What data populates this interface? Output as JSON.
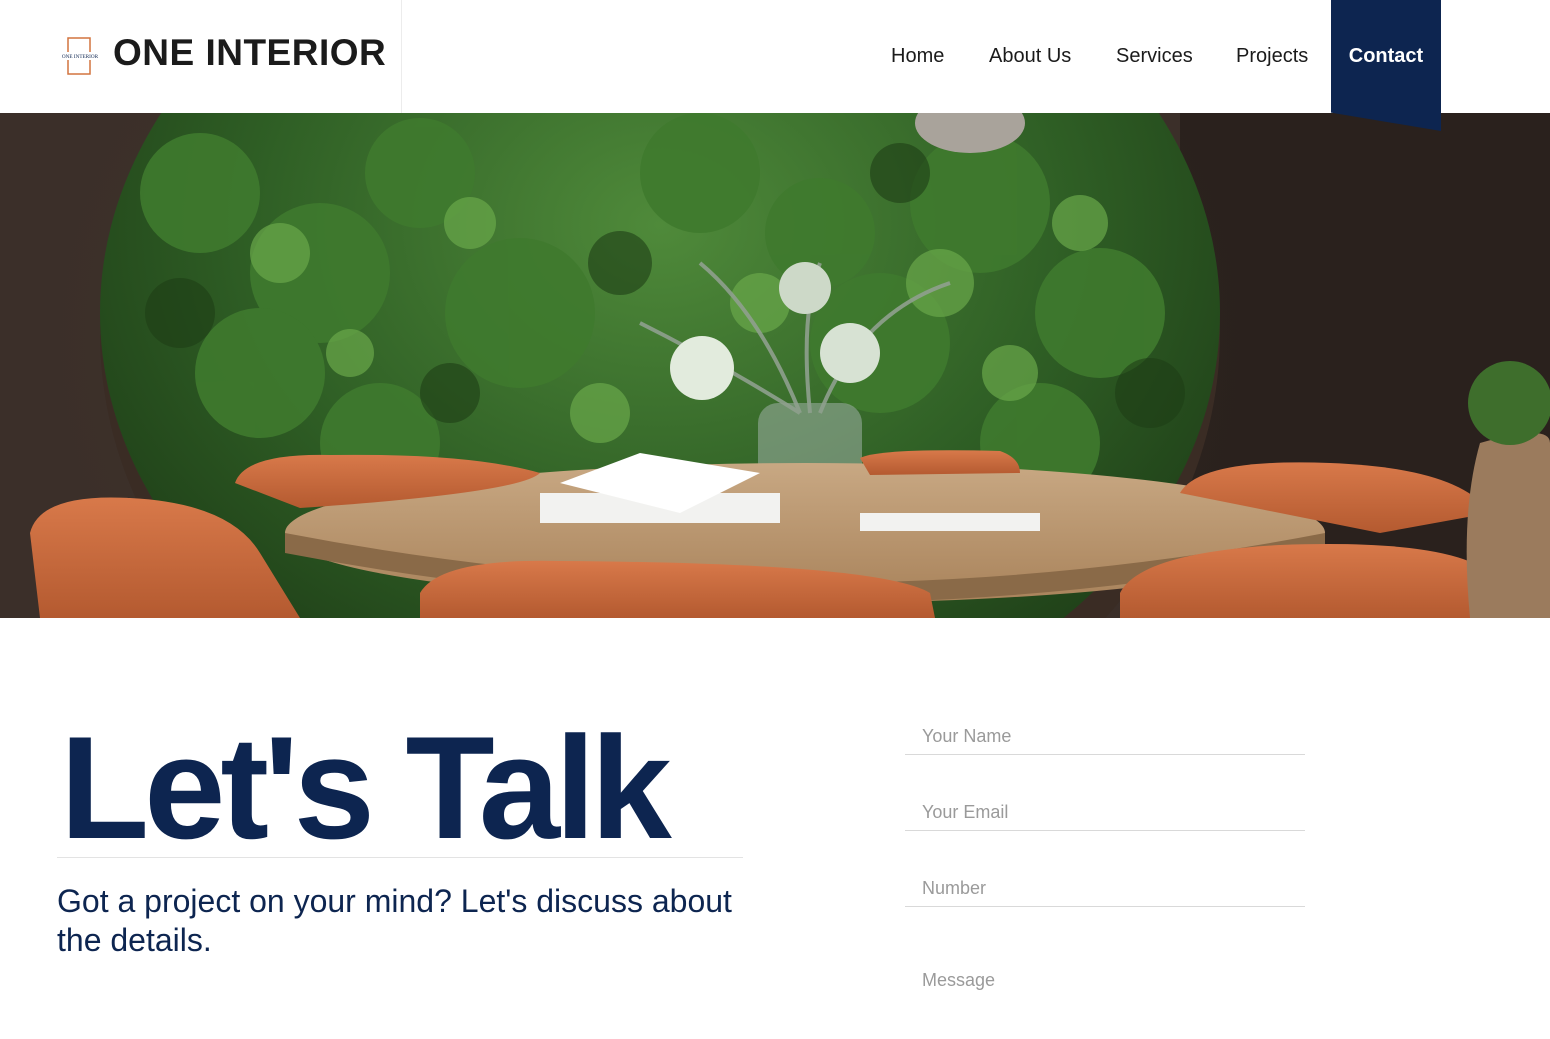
{
  "brand": {
    "name": "ONE INTERIOR",
    "logo_text": "ONE INTERIOR"
  },
  "nav": {
    "items": [
      {
        "label": "Home"
      },
      {
        "label": "About Us"
      },
      {
        "label": "Services"
      },
      {
        "label": "Projects"
      },
      {
        "label": "Contact",
        "active": true
      }
    ]
  },
  "hero": {
    "image": "interior dining room with green plant wall, round wooden table and terracotta chairs"
  },
  "contact": {
    "headline": "Let's Talk",
    "subtext": "Got a project on your mind? Let's discuss about the details.",
    "form": {
      "name_placeholder": "Your Name",
      "email_placeholder": "Your Email",
      "number_placeholder": "Number",
      "message_placeholder": "Message"
    }
  },
  "colors": {
    "navy": "#0d2550",
    "accent_orange": "#d2743f",
    "text_dark": "#1b1b1b",
    "placeholder": "#9a9a9a"
  }
}
